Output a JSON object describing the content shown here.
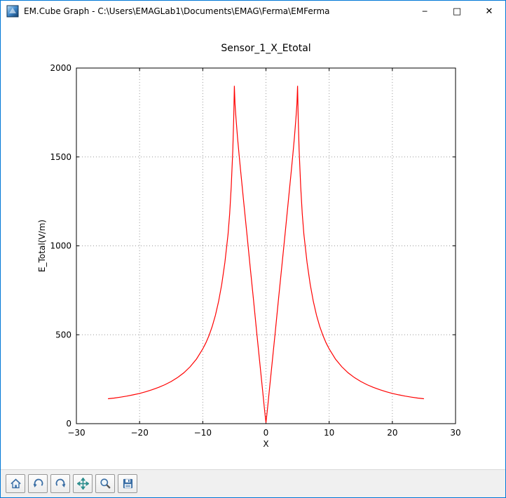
{
  "window": {
    "title": "EM.Cube Graph - C:\\Users\\EMAGLab1\\Documents\\EMAG\\Ferma\\EMFerma",
    "accent_color": "#0078d7",
    "controls": {
      "minimize": "─",
      "maximize": "□",
      "close": "✕"
    }
  },
  "toolbar": {
    "buttons": [
      {
        "icon": "home-icon"
      },
      {
        "icon": "back-arrow-icon"
      },
      {
        "icon": "forward-arrow-icon"
      },
      {
        "icon": "pan-arrows-icon"
      },
      {
        "icon": "zoom-magnifier-icon"
      },
      {
        "icon": "save-floppy-icon"
      }
    ]
  },
  "chart_data": {
    "type": "line",
    "title": "Sensor_1_X_Etotal",
    "xlabel": "X",
    "ylabel": "E_Total(V/m)",
    "xlim": [
      -30,
      30
    ],
    "ylim": [
      0,
      2000
    ],
    "xticks": [
      -30,
      -20,
      -10,
      0,
      10,
      20,
      30
    ],
    "yticks": [
      0,
      500,
      1000,
      1500,
      2000
    ],
    "grid": true,
    "grid_style": "dotted",
    "line_color": "#ff0000",
    "series": [
      {
        "name": "E_Total",
        "x": [
          -25,
          -24,
          -23,
          -22,
          -21,
          -20,
          -19,
          -18,
          -17,
          -16,
          -15,
          -14,
          -13,
          -12,
          -11,
          -10,
          -9.5,
          -9,
          -8.5,
          -8,
          -7.5,
          -7,
          -6.5,
          -6,
          -5.75,
          -5.5,
          -5.25,
          -5.1,
          -5,
          -4.9,
          -4.75,
          -4.5,
          -4.25,
          -4,
          -3.5,
          -3,
          -2.5,
          -2,
          -1.5,
          -1,
          -0.5,
          -0.25,
          0,
          0.25,
          0.5,
          1,
          1.5,
          2,
          2.5,
          3,
          3.5,
          4,
          4.25,
          4.5,
          4.75,
          4.9,
          5,
          5.1,
          5.25,
          5.5,
          5.75,
          6,
          6.5,
          7,
          7.5,
          8,
          8.5,
          9,
          9.5,
          10,
          11,
          12,
          13,
          14,
          15,
          16,
          17,
          18,
          19,
          20,
          21,
          22,
          23,
          24,
          25
        ],
        "y": [
          140,
          144,
          149,
          155,
          162,
          170,
          180,
          191,
          204,
          219,
          237,
          259,
          286,
          320,
          363,
          420,
          455,
          497,
          548,
          610,
          687,
          784,
          907,
          1065,
          1180,
          1330,
          1540,
          1720,
          1900,
          1800,
          1720,
          1610,
          1510,
          1420,
          1240,
          1060,
          880,
          705,
          525,
          350,
          175,
          88,
          5,
          88,
          175,
          350,
          525,
          705,
          880,
          1060,
          1240,
          1420,
          1510,
          1610,
          1720,
          1800,
          1900,
          1720,
          1540,
          1330,
          1180,
          1065,
          907,
          784,
          687,
          610,
          548,
          497,
          455,
          420,
          363,
          320,
          286,
          259,
          237,
          219,
          204,
          191,
          180,
          170,
          162,
          155,
          149,
          144,
          140
        ]
      }
    ]
  }
}
